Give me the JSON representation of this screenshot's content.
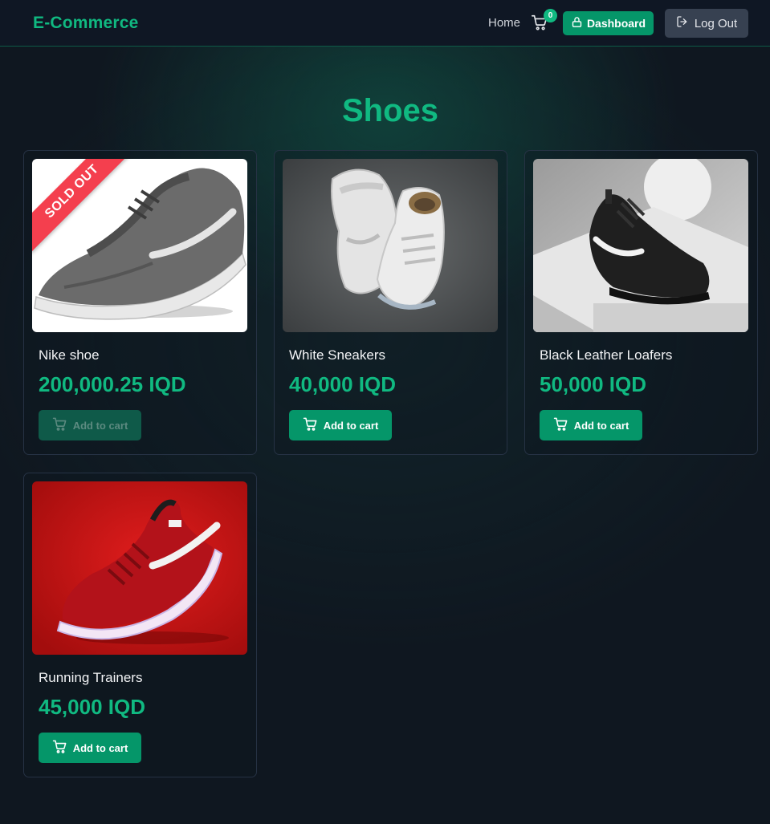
{
  "navbar": {
    "brand": "E-Commerce",
    "home_label": "Home",
    "cart_count": "0",
    "dashboard_label": "Dashboard",
    "logout_label": "Log Out"
  },
  "page": {
    "title": "Shoes"
  },
  "products": [
    {
      "name": "Nike shoe",
      "price": "200,000.25 IQD",
      "button_label": "Add to cart",
      "badge": "SOLD OUT",
      "sold_out": true,
      "image": "grey-running-shoe-white-background"
    },
    {
      "name": "White Sneakers",
      "price": "40,000 IQD",
      "button_label": "Add to cart",
      "sold_out": false,
      "image": "white-high-top-sneakers-on-stone"
    },
    {
      "name": "Black Leather Loafers",
      "price": "50,000 IQD",
      "button_label": "Add to cart",
      "sold_out": false,
      "image": "black-sneaker-on-white-shelf"
    },
    {
      "name": "Running Trainers",
      "price": "45,000 IQD",
      "button_label": "Add to cart",
      "sold_out": false,
      "image": "red-running-shoe-red-background"
    }
  ],
  "colors": {
    "accent": "#10b981",
    "button": "#059669",
    "sold_out": "#f43f4e",
    "background": "#0f1720"
  }
}
